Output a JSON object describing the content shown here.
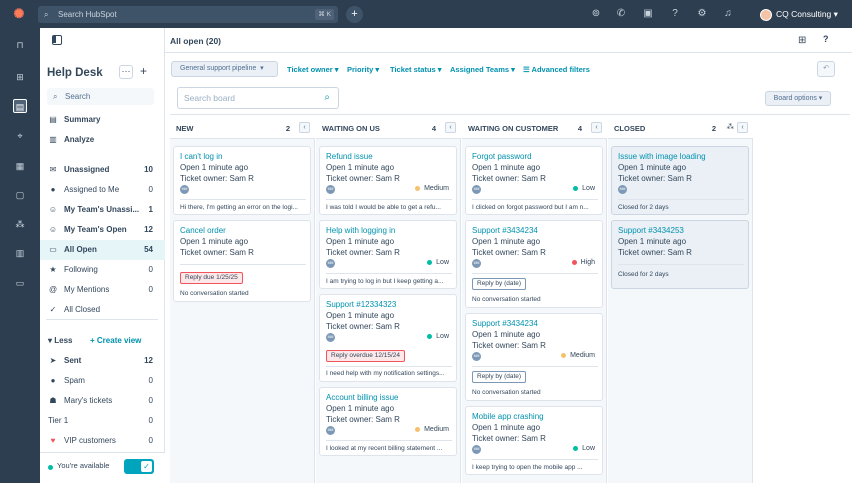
{
  "topbar": {
    "search_placeholder": "Search HubSpot",
    "search_shortcut": "⌘ K",
    "account_name": "CQ Consulting"
  },
  "sidepanel": {
    "title": "Help Desk",
    "more": "···",
    "add": "+",
    "search_placeholder": "Search",
    "items": [
      {
        "icon": "▤",
        "label": "Summary",
        "count": ""
      },
      {
        "icon": "▥",
        "label": "Analyze",
        "count": ""
      },
      {
        "icon": "✉",
        "label": "Unassigned",
        "count": "10"
      },
      {
        "icon": "●",
        "label": "Assigned to Me",
        "count": "0"
      },
      {
        "icon": "☺",
        "label": "My Team's Unassi...",
        "count": "1"
      },
      {
        "icon": "☺",
        "label": "My Team's Open",
        "count": "12"
      },
      {
        "icon": "▭",
        "label": "All Open",
        "count": "54"
      },
      {
        "icon": "★",
        "label": "Following",
        "count": "0"
      },
      {
        "icon": "@",
        "label": "My Mentions",
        "count": "0"
      },
      {
        "icon": "✓",
        "label": "All Closed",
        "count": ""
      },
      {
        "icon": "➤",
        "label": "Sent",
        "count": "12"
      },
      {
        "icon": "●",
        "label": "Spam",
        "count": "0"
      },
      {
        "icon": "☗",
        "label": "Mary's tickets",
        "count": "0"
      },
      {
        "icon": "",
        "label": "Tier 1",
        "count": "0"
      },
      {
        "icon": "♥",
        "label": "VIP customers",
        "count": "0"
      }
    ],
    "less_label": "Less",
    "create_view_label": "Create view",
    "available_label": "You're available"
  },
  "main": {
    "title": "All open (20)",
    "pipeline": "General support pipeline",
    "filters": [
      "Ticket owner",
      "Priority",
      "Ticket status",
      "Assigned Teams"
    ],
    "advanced_filters": "Advanced filters",
    "board_search_placeholder": "Search board",
    "board_options": "Board options"
  },
  "columns": [
    {
      "title": "NEW",
      "count": "2",
      "cards": [
        {
          "title": "I can't log in",
          "time": "Open 1 minute ago",
          "owner": "Ticket owner: Sam R",
          "priority": "",
          "priority_color": "",
          "preview": "Hi there, I'm getting an error on the logi...",
          "tag": "",
          "sub": ""
        },
        {
          "title": "Cancel order",
          "time": "Open 1 minute ago",
          "owner": "Ticket owner: Sam R",
          "priority": "",
          "priority_color": "",
          "preview": "",
          "tag": "Reply due 1/25/25",
          "sub": "No conversation started"
        }
      ]
    },
    {
      "title": "WAITING ON US",
      "count": "4",
      "cards": [
        {
          "title": "Refund issue",
          "time": "Open 1 minute ago",
          "owner": "Ticket owner: Sam R",
          "priority": "Medium",
          "priority_color": "#f5c26b",
          "preview": "I was told I would be able to get a refu...",
          "tag": "",
          "sub": ""
        },
        {
          "title": "Help with logging in",
          "time": "Open 1 minute ago",
          "owner": "Ticket owner: Sam R",
          "priority": "Low",
          "priority_color": "#00bda5",
          "preview": "I am trying to log in but I keep getting a...",
          "tag": "",
          "sub": ""
        },
        {
          "title": "Support #12334323",
          "time": "Open 1 minute ago",
          "owner": "Ticket owner: Sam R",
          "priority": "Low",
          "priority_color": "#00bda5",
          "preview": "I need help with my notification settings...",
          "tag": "Reply overdue 12/15/24",
          "sub": ""
        },
        {
          "title": "Account billing issue",
          "time": "Open 1 minute ago",
          "owner": "Ticket owner: Sam R",
          "priority": "Medium",
          "priority_color": "#f5c26b",
          "preview": "I looked at my recent billing statement ...",
          "tag": "",
          "sub": ""
        }
      ]
    },
    {
      "title": "WAITING ON CUSTOMER",
      "count": "4",
      "cards": [
        {
          "title": "Forgot password",
          "time": "Open 1 minute ago",
          "owner": "Ticket owner: Sam R",
          "priority": "Low",
          "priority_color": "#00bda5",
          "preview": "I clicked on forgot password but I am n...",
          "tag": "",
          "sub": ""
        },
        {
          "title": "Support #3434234",
          "time": "Open 1 minute ago",
          "owner": "Ticket owner: Sam R",
          "priority": "High",
          "priority_color": "#f2545b",
          "preview": "",
          "tag": "Reply by (date)",
          "sub": "No conversation started"
        },
        {
          "title": "Support #3434234",
          "time": "Open 1 minute ago",
          "owner": "Ticket owner: Sam R",
          "priority": "Medium",
          "priority_color": "#f5c26b",
          "preview": "",
          "tag": "Reply by (date)",
          "sub": "No conversation started"
        },
        {
          "title": "Mobile app crashing",
          "time": "Open 1 minute ago",
          "owner": "Ticket owner: Sam R",
          "priority": "Low",
          "priority_color": "#00bda5",
          "preview": "I keep trying to open the mobile app ...",
          "tag": "",
          "sub": ""
        }
      ]
    },
    {
      "title": "CLOSED",
      "count": "2",
      "cards": [
        {
          "title": "Issue with image loading",
          "time": "Open 1 minute ago",
          "owner": "Ticket owner: Sam R",
          "priority": "",
          "priority_color": "",
          "preview": "",
          "tag": "",
          "sub": "Closed for 2 days"
        },
        {
          "title": "Support #3434253",
          "time": "Open 1 minute ago",
          "owner": "Ticket owner: Sam R",
          "priority": "",
          "priority_color": "",
          "preview": "",
          "tag": "",
          "sub": "Closed for 2 days"
        }
      ]
    }
  ],
  "colors": {
    "accent": "#0091ae",
    "topbar": "#2d3e50",
    "brand": "#ff7a59"
  }
}
